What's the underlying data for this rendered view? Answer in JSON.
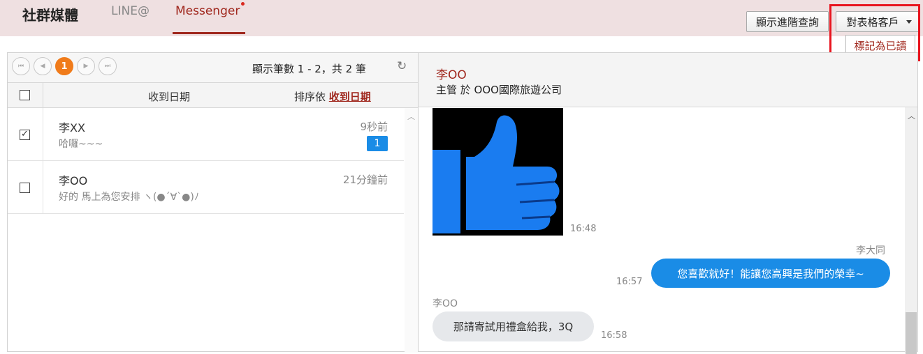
{
  "header": {
    "brand": "社群媒體",
    "tabs": [
      {
        "label": "LINE@"
      },
      {
        "label": "Messenger",
        "active": true
      }
    ],
    "advanced_search_label": "顯示進階查詢",
    "customer_dropdown_label": "對表格客戶",
    "dropdown_menu": {
      "mark_read_label": "標記為已讀"
    },
    "colors": {
      "accent": "#a0281e",
      "highlight": "#e8141e",
      "header_bg": "#efe0e1"
    }
  },
  "list_panel": {
    "pager": {
      "current_page": "1",
      "summary": "顯示筆數 1 - 2，共 2 筆"
    },
    "columns": {
      "date_label": "收到日期",
      "sort_prefix": "排序依",
      "sort_field": "收到日期"
    },
    "rows": [
      {
        "name": "李XX",
        "preview": "哈囉~~~",
        "time": "9秒前",
        "unread": "1",
        "checked": true
      },
      {
        "name": "李OO",
        "preview": "好的 馬上為您安排 ヽ(●´∀`●)ﾉ",
        "time": "21分鐘前",
        "checked": false
      }
    ]
  },
  "chat_panel": {
    "contact_name": "李OO",
    "contact_sub": "主管 於 OOO國際旅遊公司",
    "messages": [
      {
        "type": "image",
        "icon": "thumbs-up-icon",
        "time": "16:48"
      },
      {
        "type": "outgoing",
        "sender": "李大同",
        "text": "您喜歡就好！能讓您高興是我們的榮幸~",
        "time": "16:57"
      },
      {
        "type": "incoming",
        "sender": "李OO",
        "text": "那請寄試用禮盒給我，3Q",
        "time": "16:58"
      }
    ],
    "colors": {
      "outgoing_bubble": "#1a8ce6",
      "incoming_bubble": "#e6e8eb",
      "thumb_blue": "#1a7cf0"
    }
  }
}
